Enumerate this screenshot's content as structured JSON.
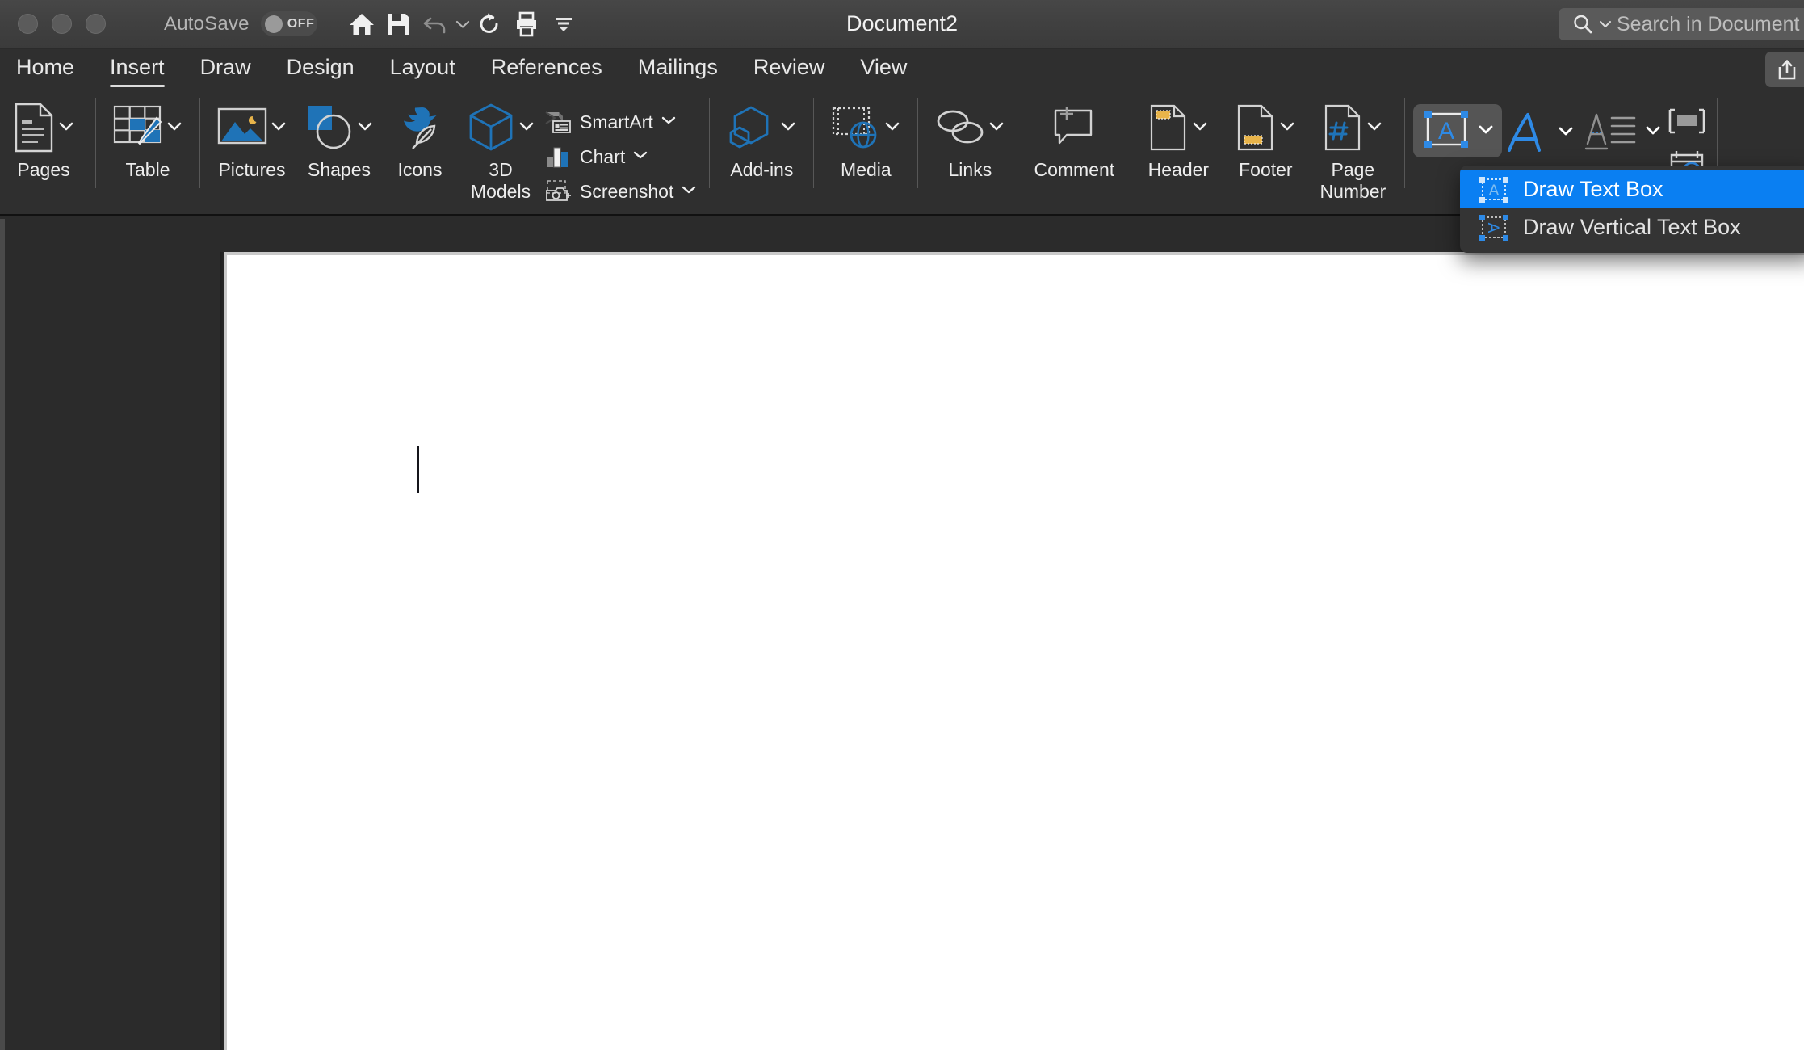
{
  "window": {
    "title": "Document2",
    "autosave_label": "AutoSave",
    "autosave_state": "OFF",
    "traffic_lights": [
      "close",
      "minimize",
      "maximize"
    ],
    "quick_access": [
      {
        "name": "home-icon",
        "label": "Home"
      },
      {
        "name": "save-icon",
        "label": "Save"
      },
      {
        "name": "undo-icon",
        "label": "Undo"
      },
      {
        "name": "undo-caret-icon",
        "label": "Undo options"
      },
      {
        "name": "redo-icon",
        "label": "Redo"
      },
      {
        "name": "print-icon",
        "label": "Print"
      },
      {
        "name": "customize-toolbar-icon",
        "label": "Customize Quick Access Toolbar"
      }
    ],
    "share_label": "Share"
  },
  "search": {
    "placeholder": "Search in Document",
    "icon": "search-icon"
  },
  "tabs": [
    {
      "label": "Home",
      "active": false
    },
    {
      "label": "Insert",
      "active": true
    },
    {
      "label": "Draw",
      "active": false
    },
    {
      "label": "Design",
      "active": false
    },
    {
      "label": "Layout",
      "active": false
    },
    {
      "label": "References",
      "active": false
    },
    {
      "label": "Mailings",
      "active": false
    },
    {
      "label": "Review",
      "active": false
    },
    {
      "label": "View",
      "active": false
    }
  ],
  "ribbon": {
    "large_items": [
      {
        "label": "Pages",
        "icon": "pages-icon",
        "has_caret": true
      },
      {
        "label": "Table",
        "icon": "table-icon",
        "has_caret": true
      },
      {
        "label": "Pictures",
        "icon": "pictures-icon",
        "has_caret": true
      },
      {
        "label": "Shapes",
        "icon": "shapes-icon",
        "has_caret": true
      },
      {
        "label": "Icons",
        "icon": "icons-icon",
        "has_caret": false
      },
      {
        "label": "3D\nModels",
        "icon": "3d-models-icon",
        "has_caret": true
      },
      {
        "label": "Add-ins",
        "icon": "addins-icon",
        "has_caret": true
      },
      {
        "label": "Media",
        "icon": "media-icon",
        "has_caret": true
      },
      {
        "label": "Links",
        "icon": "links-icon",
        "has_caret": true
      },
      {
        "label": "Comment",
        "icon": "comment-icon",
        "has_caret": false
      },
      {
        "label": "Header",
        "icon": "header-icon",
        "has_caret": true
      },
      {
        "label": "Footer",
        "icon": "footer-icon",
        "has_caret": true
      },
      {
        "label": "Page\nNumber",
        "icon": "page-number-icon",
        "has_caret": true
      }
    ],
    "stacked_items": [
      {
        "label": "SmartArt",
        "icon": "smartart-icon",
        "has_caret": true
      },
      {
        "label": "Chart",
        "icon": "chart-icon",
        "has_caret": true
      },
      {
        "label": "Screenshot",
        "icon": "screenshot-icon",
        "has_caret": true
      }
    ],
    "text_group": [
      {
        "name": "text-box-button",
        "icon": "text-box-icon",
        "pressed": true,
        "has_caret": true
      },
      {
        "name": "wordart-button",
        "icon": "wordart-icon",
        "pressed": false,
        "has_caret": true
      },
      {
        "name": "drop-cap-button",
        "icon": "drop-cap-icon",
        "pressed": false,
        "has_caret": true
      }
    ],
    "mini_items": [
      {
        "name": "text-field-button",
        "icon": "text-field-icon"
      },
      {
        "name": "date-time-button",
        "icon": "date-time-icon"
      }
    ]
  },
  "dropdown": {
    "open": true,
    "items": [
      {
        "label": "Draw Text Box",
        "icon": "draw-text-box-icon",
        "selected": true
      },
      {
        "label": "Draw Vertical Text Box",
        "icon": "draw-vertical-text-box-icon",
        "selected": false
      }
    ]
  },
  "document": {
    "page_name": "page-1",
    "cursor_visible": true,
    "content": ""
  },
  "colors": {
    "accent_blue": "#0a7ff2",
    "office_blue": "#1f73b7",
    "ribbon_bg": "#2f2f2f",
    "workspace_bg": "#2b2b2b",
    "titlebar_bg": "#414141",
    "page_white": "#ffffff",
    "amber": "#e8b44a"
  }
}
